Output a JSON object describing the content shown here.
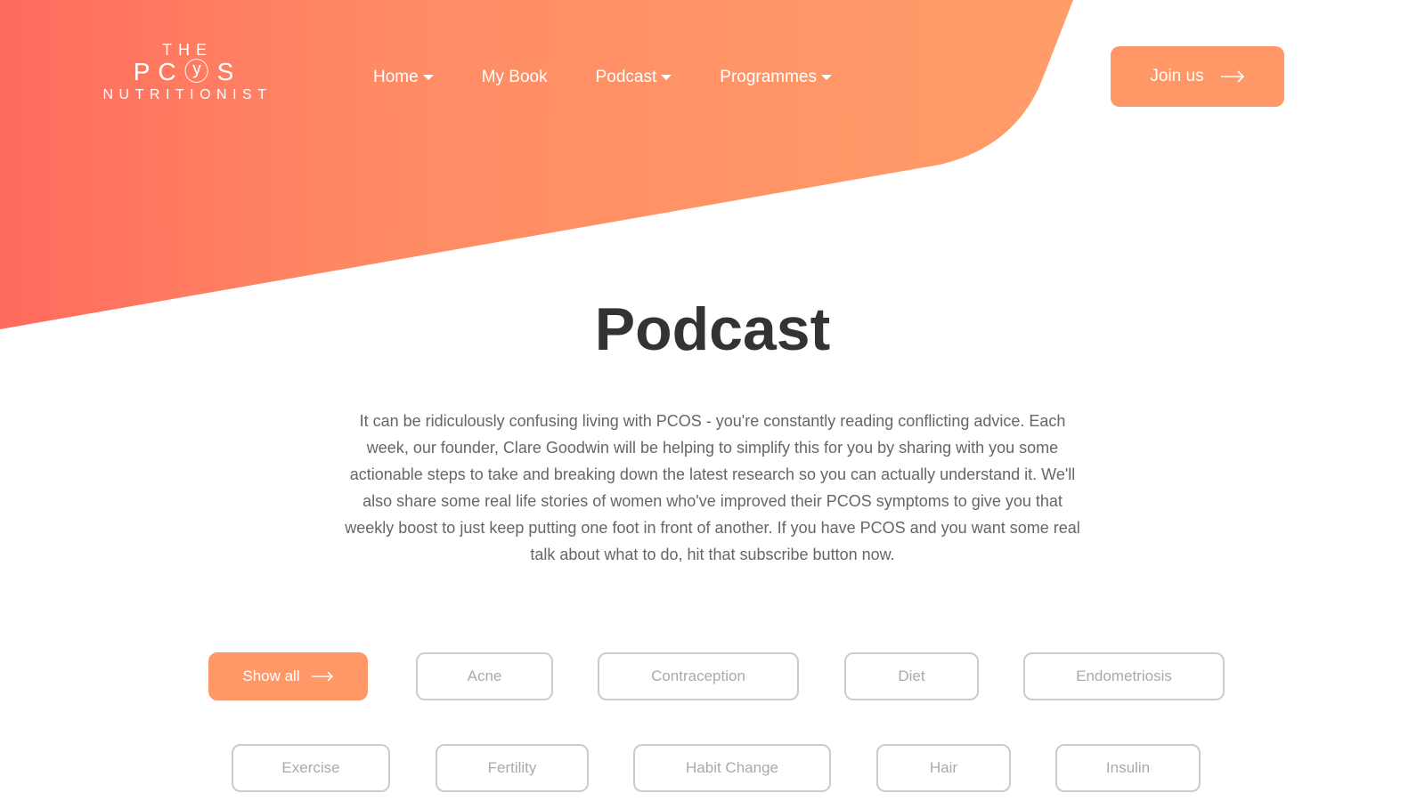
{
  "logo": {
    "line1": "THE",
    "line2": "PCⓨS",
    "line3": "NUTRITIONIST"
  },
  "nav": {
    "items": [
      {
        "label": "Home",
        "dropdown": true
      },
      {
        "label": "My Book",
        "dropdown": false
      },
      {
        "label": "Podcast",
        "dropdown": true
      },
      {
        "label": "Programmes",
        "dropdown": true
      }
    ],
    "join_label": "Join us"
  },
  "page": {
    "title": "Podcast",
    "intro": "It can be ridiculously confusing living with PCOS - you're constantly reading conflicting advice. Each week, our founder, Clare Goodwin will be helping to simplify this for you by sharing with you some actionable steps to take and breaking down the latest research so you can actually understand it. We'll also share some real life stories of women who've improved their PCOS symptoms to give you that weekly boost to just keep putting one foot in front of another. If you have PCOS and you want some real talk about what to do, hit that subscribe button now."
  },
  "filters": {
    "show_all": "Show all",
    "tags": [
      "Acne",
      "Contraception",
      "Diet",
      "Endometriosis",
      "Exercise",
      "Fertility",
      "Habit Change",
      "Hair",
      "Insulin"
    ]
  },
  "colors": {
    "accent": "#ff9866",
    "gradient_start": "#ff6b5e",
    "gradient_end": "#ff9d69",
    "title": "#333333",
    "body_text": "#666666"
  },
  "icons": {
    "arrow": "arrow-right-icon",
    "caret": "caret-down-icon"
  }
}
